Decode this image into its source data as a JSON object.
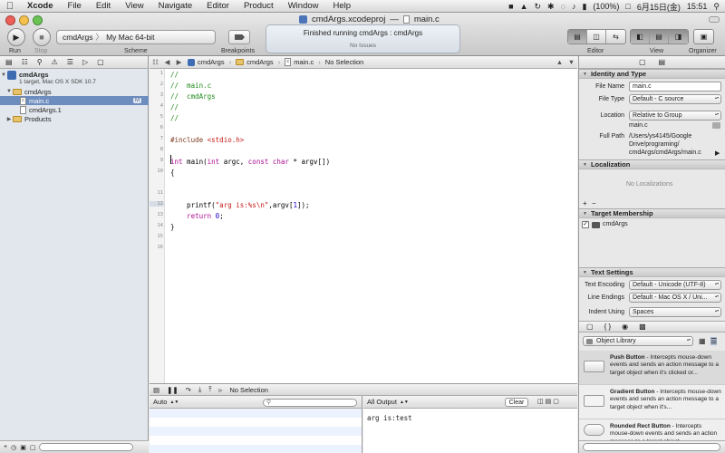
{
  "menubar": {
    "apple": "",
    "app": "Xcode",
    "items": [
      "File",
      "Edit",
      "View",
      "Navigate",
      "Editor",
      "Product",
      "Window",
      "Help"
    ],
    "battery": "(100%)",
    "date": "6月15日(金)",
    "time": "15:51"
  },
  "window": {
    "title_project": "cmdArgs.xcodeproj",
    "title_sep": "—",
    "title_file": "main.c"
  },
  "toolbar": {
    "run_label": "Run",
    "stop_label": "Stop",
    "scheme_label": "Scheme",
    "scheme_target": "cmdArgs",
    "scheme_sep": "〉",
    "scheme_dest": "My Mac 64-bit",
    "breakpoints_label": "Breakpoints",
    "activity_status": "Finished running cmdArgs : cmdArgs",
    "activity_issues": "No Issues",
    "editor_label": "Editor",
    "view_label": "View",
    "organizer_label": "Organizer"
  },
  "navigator": {
    "project_name": "cmdArgs",
    "project_sub": "1 target, Mac OS X SDK 10.7",
    "group_name": "cmdArgs",
    "selected_file": "main.c",
    "selected_badge": "M",
    "man_file": "cmdArgs.1",
    "products": "Products"
  },
  "jumpbar": {
    "crumbs": [
      "cmdArgs",
      "cmdArgs",
      "main.c",
      "No Selection"
    ]
  },
  "editor": {
    "line_numbers": [
      "1",
      "2",
      "3",
      "4",
      "5",
      "6",
      "7",
      "8",
      "9",
      "10",
      "11",
      "12",
      "13",
      "14",
      "15",
      "16"
    ],
    "lines": {
      "l1": "//",
      "l2": "//  main.c",
      "l3": "//  cmdArgs",
      "l4": "//",
      "l5": "//",
      "l7_dir": "#include ",
      "l7_hdr": "<stdio.h>",
      "l9_kw1": "int",
      "l9_a": " main(",
      "l9_kw2": "int",
      "l9_b": " argc, ",
      "l9_kw3": "const",
      "l9_c": " ",
      "l9_kw4": "char",
      "l9_d": " * argv[])",
      "l10": "{",
      "l12_a": "    printf(",
      "l12_str": "\"arg is:%s\\n\"",
      "l12_b": ",argv[",
      "l12_num": "1",
      "l12_c": "]);",
      "l13_kw": "    return",
      "l13_a": " ",
      "l13_num": "0",
      "l13_b": ";",
      "l14": "}"
    }
  },
  "debugbar": {
    "no_selection": "No Selection"
  },
  "variables": {
    "scope": "Auto"
  },
  "console": {
    "output_mode": "All Output",
    "clear_label": "Clear",
    "output": "arg is:test"
  },
  "inspector": {
    "identity_title": "Identity and Type",
    "file_name_label": "File Name",
    "file_name": "main.c",
    "file_type_label": "File Type",
    "file_type": "Default - C source",
    "location_label": "Location",
    "location": "Relative to Group",
    "location_file": "main.c",
    "full_path_label": "Full Path",
    "full_path_lines": [
      "/Users/ys4145/Google",
      "Drive/programing/",
      "cmdArgs/cmdArgs/main.c"
    ],
    "localization_title": "Localization",
    "no_localizations": "No Localizations",
    "target_membership_title": "Target Membership",
    "target_name": "cmdArgs",
    "text_settings_title": "Text Settings",
    "text_encoding_label": "Text Encoding",
    "text_encoding": "Default - Unicode (UTF-8)",
    "line_endings_label": "Line Endings",
    "line_endings": "Default - Mac OS X / Uni...",
    "indent_using_label": "Indent Using",
    "indent_using": "Spaces"
  },
  "library": {
    "selector": "Object Library",
    "items": [
      {
        "name": "Push Button",
        "desc": " - Intercepts mouse-down events and sends an action message to a target object when it's clicked or..."
      },
      {
        "name": "Gradient Button",
        "desc": " - Intercepts mouse-down events and sends an action message to a target object when it's..."
      },
      {
        "name": "Rounded Rect Button",
        "desc": " - Intercepts mouse-down events and sends an action message to a target object..."
      }
    ]
  }
}
